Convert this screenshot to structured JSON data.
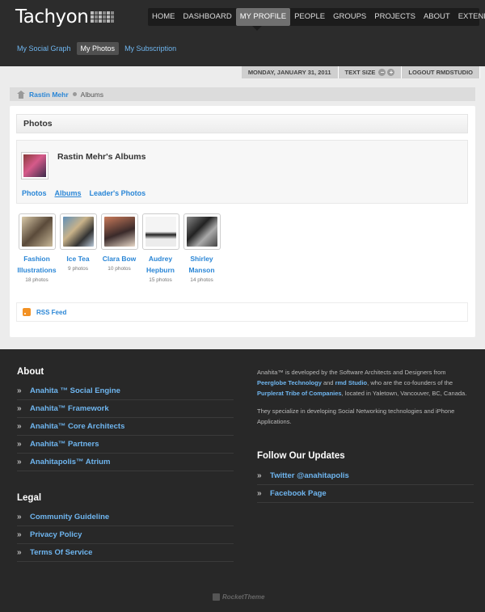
{
  "header": {
    "logo_text": "Tachyon",
    "nav": [
      "HOME",
      "DASHBOARD",
      "MY PROFILE",
      "PEOPLE",
      "GROUPS",
      "PROJECTS"
    ],
    "nav_right": [
      "ABOUT",
      "EXTEND"
    ],
    "active_nav": "MY PROFILE",
    "subnav": [
      "My Social Graph",
      "My Photos",
      "My Subscription"
    ],
    "active_subnav": "My Photos"
  },
  "topbar": {
    "date": "MONDAY, JANUARY 31, 2011",
    "text_size_label": "TEXT SIZE",
    "text_size_minus": "−",
    "text_size_plus": "+",
    "logout": "LOGOUT RMDSTUDIO"
  },
  "breadcrumb": {
    "link": "Rastin Mehr",
    "current": "Albums"
  },
  "panel": {
    "title": "Photos",
    "owner_title": "Rastin Mehr's Albums",
    "tabs": [
      "Photos",
      "Albums",
      "Leader's Photos"
    ],
    "active_tab": "Albums",
    "albums": [
      {
        "name_line1": "Fashion",
        "name_line2": "Illustrations",
        "count": "18 photos"
      },
      {
        "name_line1": "Ice Tea",
        "name_line2": "",
        "count": "9 photos"
      },
      {
        "name_line1": "Clara Bow",
        "name_line2": "",
        "count": "10 photos"
      },
      {
        "name_line1": "Audrey",
        "name_line2": "Hepburn",
        "count": "15 photos"
      },
      {
        "name_line1": "Shirley",
        "name_line2": "Manson",
        "count": "14 photos"
      }
    ],
    "rss_label": "RSS Feed"
  },
  "footer": {
    "about_heading": "About",
    "about_links": [
      "Anahita ™ Social Engine",
      "Anahita™ Framework",
      "Anahita™ Core Architects",
      "Anahita™ Partners",
      "Anahitapolis™ Atrium"
    ],
    "legal_heading": "Legal",
    "legal_links": [
      "Community Guideline",
      "Privacy Policy",
      "Terms Of Service"
    ],
    "about_text": {
      "p1_a": "Anahita™ is developed by the Software Architects and Designers from ",
      "p1_link1": "Peerglobe Technology",
      "p1_b": " and ",
      "p1_link2": "rmd Studio",
      "p1_c": ", who are the co-founders of the ",
      "p1_link3": "Purplerat Tribe of Companies",
      "p1_d": ", located in Yaletown, Vancouver, BC, Canada.",
      "p2": "They specialize in developing Social Networking technologies and iPhone Applications."
    },
    "follow_heading": "Follow Our Updates",
    "follow_links": [
      "Twitter @anahitapolis",
      "Facebook Page"
    ],
    "credit": "RocketTheme"
  }
}
